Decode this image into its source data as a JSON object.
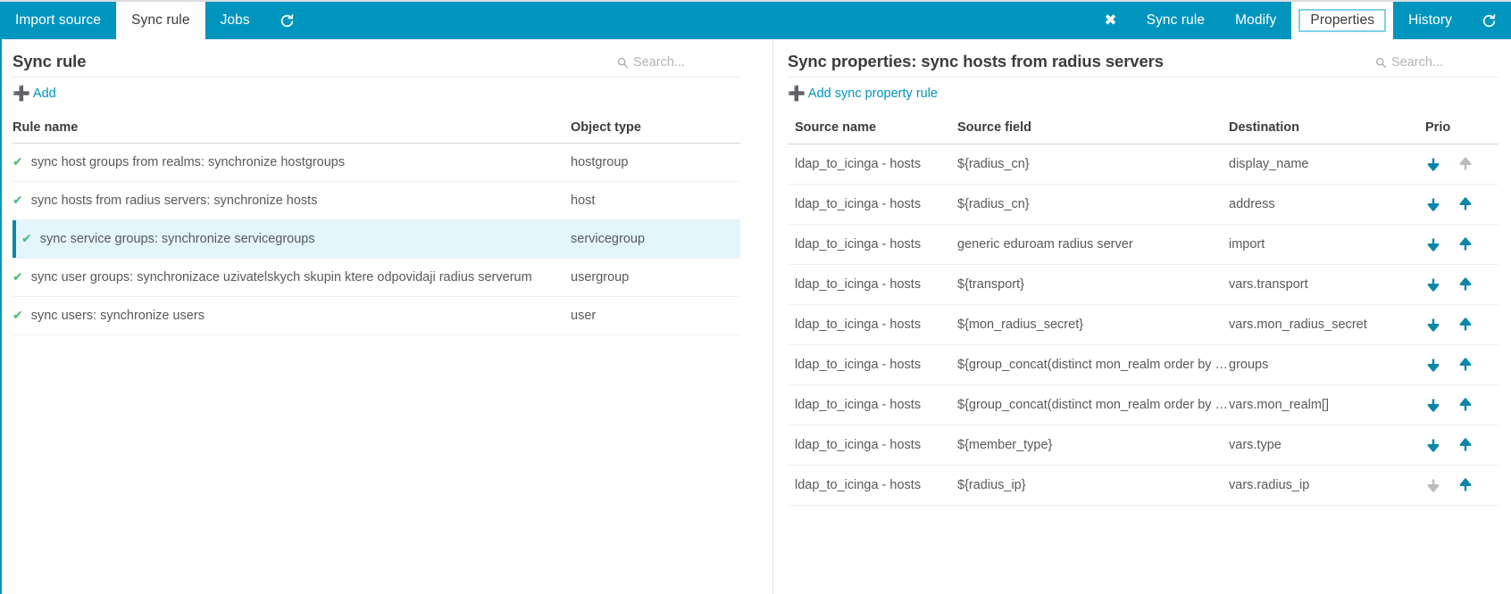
{
  "topbar": {
    "left_tabs": [
      {
        "label": "Import source",
        "active": false
      },
      {
        "label": "Sync rule",
        "active": true
      },
      {
        "label": "Jobs",
        "active": false
      }
    ],
    "left_refresh_icon": "refresh-icon",
    "close_icon": "close-icon",
    "close_label": "✖",
    "right_tabs": [
      {
        "label": "Sync rule",
        "state": "normal"
      },
      {
        "label": "Modify",
        "state": "normal"
      },
      {
        "label": "Properties",
        "state": "focused"
      },
      {
        "label": "History",
        "state": "normal"
      }
    ],
    "right_refresh_icon": "refresh-icon",
    "accent_color": "#0095bf"
  },
  "left_pane": {
    "title": "Sync rule",
    "search": {
      "placeholder": "Search...",
      "value": "",
      "icon": "search-icon"
    },
    "add_label": "Add",
    "table": {
      "headers": [
        "Rule name",
        "Object type"
      ],
      "rows": [
        {
          "status_icon": "check-icon",
          "name": "sync host groups from realms: synchronize hostgroups",
          "object_type": "hostgroup",
          "selected": false
        },
        {
          "status_icon": "check-icon",
          "name": "sync hosts from radius servers: synchronize hosts",
          "object_type": "host",
          "selected": false
        },
        {
          "status_icon": "check-icon",
          "name": "sync service groups: synchronize servicegroups",
          "object_type": "servicegroup",
          "selected": true
        },
        {
          "status_icon": "check-icon",
          "name": "sync user groups: synchronizace uzivatelskych skupin ktere odpovidaji radius serverum",
          "object_type": "usergroup",
          "selected": false
        },
        {
          "status_icon": "check-icon",
          "name": "sync users: synchronize users",
          "object_type": "user",
          "selected": false
        }
      ]
    }
  },
  "right_pane": {
    "title": "Sync properties: sync hosts from radius servers",
    "search": {
      "placeholder": "Search...",
      "value": "",
      "icon": "search-icon"
    },
    "add_label": "Add sync property rule",
    "table": {
      "headers": [
        "Source name",
        "Source field",
        "Destination",
        "Prio"
      ],
      "rows": [
        {
          "source_name": "ldap_to_icinga - hosts",
          "source_field": "${radius_cn}",
          "destination": "display_name",
          "down_enabled": true,
          "up_enabled": false
        },
        {
          "source_name": "ldap_to_icinga - hosts",
          "source_field": "${radius_cn}",
          "destination": "address",
          "down_enabled": true,
          "up_enabled": true
        },
        {
          "source_name": "ldap_to_icinga - hosts",
          "source_field": "generic eduroam radius server",
          "destination": "import",
          "down_enabled": true,
          "up_enabled": true
        },
        {
          "source_name": "ldap_to_icinga - hosts",
          "source_field": "${transport}",
          "destination": "vars.transport",
          "down_enabled": true,
          "up_enabled": true
        },
        {
          "source_name": "ldap_to_icinga - hosts",
          "source_field": "${mon_radius_secret}",
          "destination": "vars.mon_radius_secret",
          "down_enabled": true,
          "up_enabled": true
        },
        {
          "source_name": "ldap_to_icinga - hosts",
          "source_field": "${group_concat(distinct mon_realm order by mon_realm)}",
          "destination": "groups",
          "down_enabled": true,
          "up_enabled": true
        },
        {
          "source_name": "ldap_to_icinga - hosts",
          "source_field": "${group_concat(distinct mon_realm order by mon_realm)}",
          "destination": "vars.mon_realm[]",
          "down_enabled": true,
          "up_enabled": true
        },
        {
          "source_name": "ldap_to_icinga - hosts",
          "source_field": "${member_type}",
          "destination": "vars.type",
          "down_enabled": true,
          "up_enabled": true
        },
        {
          "source_name": "ldap_to_icinga - hosts",
          "source_field": "${radius_ip}",
          "destination": "vars.radius_ip",
          "down_enabled": false,
          "up_enabled": true
        }
      ]
    }
  },
  "colors": {
    "accent": "#0095bf",
    "selected_row": "#e3f6fb",
    "selected_bar": "#0d86a8",
    "check_green": "#44bb77",
    "arrow_active": "#0d86a8",
    "arrow_disabled": "#b9bcbe"
  }
}
